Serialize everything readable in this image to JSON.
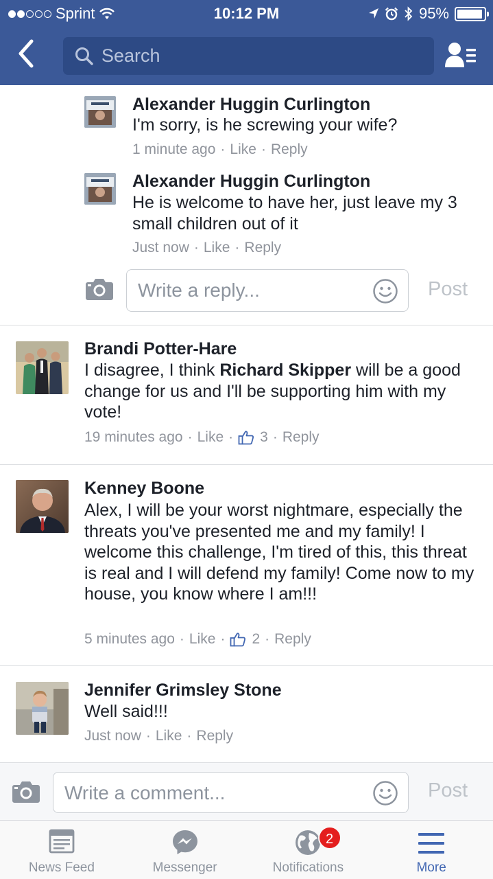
{
  "status_bar": {
    "carrier": "Sprint",
    "signal_bars_filled": 2,
    "signal_bars_total": 5,
    "time": "10:12 PM",
    "battery": "95%",
    "battery_level": 0.95
  },
  "header": {
    "search_placeholder": "Search"
  },
  "replies": [
    {
      "name": "Alexander Huggin Curlington",
      "text": "I'm sorry, is he screwing your wife?",
      "time": "1 minute ago",
      "like": "Like",
      "reply": "Reply"
    },
    {
      "name": "Alexander Huggin Curlington",
      "text": "He is welcome to have her, just leave my 3 small children out of it",
      "time": "Just now",
      "like": "Like",
      "reply": "Reply"
    }
  ],
  "reply_composer": {
    "placeholder": "Write a reply...",
    "post_label": "Post"
  },
  "comments": [
    {
      "name": "Brandi Potter-Hare",
      "text_before": "I disagree, I think ",
      "mention": "Richard Skipper",
      "text_after": " will be a good change for us and I'll be supporting him with my vote!",
      "time": "19 minutes ago",
      "like": "Like",
      "likes_count": "3",
      "reply": "Reply"
    },
    {
      "name": "Kenney Boone",
      "text": "Alex, I will be your worst nightmare, especially the threats you've presented me and my family! I welcome this challenge, I'm tired of this, this threat is real and I will defend my family! Come now to my house, you know where I am!!!",
      "time": "5 minutes ago",
      "like": "Like",
      "likes_count": "2",
      "reply": "Reply"
    },
    {
      "name": "Jennifer Grimsley Stone",
      "text": "Well said!!!",
      "time": "Just now",
      "like": "Like",
      "reply": "Reply"
    }
  ],
  "comment_composer": {
    "placeholder": "Write a comment...",
    "post_label": "Post"
  },
  "tabbar": {
    "tabs": [
      {
        "label": "News Feed",
        "icon": "news-feed-icon"
      },
      {
        "label": "Messenger",
        "icon": "messenger-icon"
      },
      {
        "label": "Notifications",
        "icon": "globe-icon",
        "badge": "2"
      },
      {
        "label": "More",
        "icon": "menu-icon",
        "active": true
      }
    ]
  },
  "colors": {
    "brand": "#3b5998",
    "active_tab": "#4267b2",
    "badge": "#e41e1e",
    "meta_text": "#90949c"
  }
}
